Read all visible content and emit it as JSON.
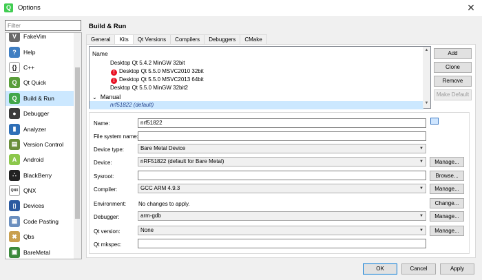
{
  "window": {
    "title": "Options",
    "close_glyph": "✕",
    "app_icon_letter": "Q"
  },
  "filter": {
    "placeholder": "Filter"
  },
  "sidebar": {
    "items": [
      {
        "label": "FakeVim",
        "icon": "fakevim-icon",
        "color": "#6a6a6a",
        "glyph": "V"
      },
      {
        "label": "Help",
        "icon": "help-icon",
        "color": "#3f7ec2",
        "glyph": "?"
      },
      {
        "label": "C++",
        "icon": "cpp-icon",
        "color": "#ffffff",
        "glyph": "{}"
      },
      {
        "label": "Qt Quick",
        "icon": "qtquick-icon",
        "color": "#5a9e3a",
        "glyph": "Q"
      },
      {
        "label": "Build & Run",
        "icon": "build-run-icon",
        "color": "#41a64b",
        "glyph": "Q"
      },
      {
        "label": "Debugger",
        "icon": "debugger-icon",
        "color": "#3b3b3b",
        "glyph": "●"
      },
      {
        "label": "Analyzer",
        "icon": "analyzer-icon",
        "color": "#2f6fb7",
        "glyph": "▮"
      },
      {
        "label": "Version Control",
        "icon": "version-control-icon",
        "color": "#6a8e3a",
        "glyph": "▤"
      },
      {
        "label": "Android",
        "icon": "android-icon",
        "color": "#8cc84b",
        "glyph": "A"
      },
      {
        "label": "BlackBerry",
        "icon": "blackberry-icon",
        "color": "#222222",
        "glyph": "∴"
      },
      {
        "label": "QNX",
        "icon": "qnx-icon",
        "color": "#ffffff",
        "glyph": "QNX"
      },
      {
        "label": "Devices",
        "icon": "devices-icon",
        "color": "#2c5aa0",
        "glyph": "▯"
      },
      {
        "label": "Code Pasting",
        "icon": "code-pasting-icon",
        "color": "#6b8fbf",
        "glyph": "▦"
      },
      {
        "label": "Qbs",
        "icon": "qbs-icon",
        "color": "#c9a050",
        "glyph": "✖"
      },
      {
        "label": "BareMetal",
        "icon": "baremetal-icon",
        "color": "#3c8a3c",
        "glyph": "▣"
      }
    ],
    "selected": "Build & Run"
  },
  "page": {
    "title": "Build & Run"
  },
  "tabs": [
    "General",
    "Kits",
    "Qt Versions",
    "Compilers",
    "Debuggers",
    "CMake"
  ],
  "active_tab": "Kits",
  "kits": {
    "header": "Name",
    "rows": [
      {
        "label": "Desktop Qt 5.4.2 MinGW 32bit",
        "warning": false
      },
      {
        "label": "Desktop Qt 5.5.0 MSVC2010 32bit",
        "warning": true
      },
      {
        "label": "Desktop Qt 5.5.0 MSVC2013 64bit",
        "warning": true
      },
      {
        "label": "Desktop Qt 5.5.0 MinGW 32bit2",
        "warning": false
      },
      {
        "label": "Manual",
        "group": true
      },
      {
        "label": "nrf51822 (default)",
        "selected": true
      }
    ],
    "buttons": {
      "add": "Add",
      "clone": "Clone",
      "remove": "Remove",
      "make_default": "Make Default"
    }
  },
  "form": {
    "name": {
      "label": "Name:",
      "value": "nrf51822"
    },
    "file_system_name": {
      "label": "File system name:",
      "value": ""
    },
    "device_type": {
      "label": "Device type:",
      "value": "Bare Metal Device"
    },
    "device": {
      "label": "Device:",
      "value": "nRF51822 (default for Bare Metal)",
      "button": "Manage..."
    },
    "sysroot": {
      "label": "Sysroot:",
      "value": "",
      "button": "Browse..."
    },
    "compiler": {
      "label": "Compiler:",
      "value": "GCC ARM 4.9.3",
      "button": "Manage..."
    },
    "environment": {
      "label": "Environment:",
      "value": "No changes to apply.",
      "button": "Change..."
    },
    "debugger": {
      "label": "Debugger:",
      "value": "arm-gdb",
      "button": "Manage..."
    },
    "qt_version": {
      "label": "Qt version:",
      "value": "None",
      "button": "Manage..."
    },
    "qt_mkspec": {
      "label": "Qt mkspec:",
      "value": ""
    }
  },
  "footer": {
    "ok": "OK",
    "cancel": "Cancel",
    "apply": "Apply"
  }
}
